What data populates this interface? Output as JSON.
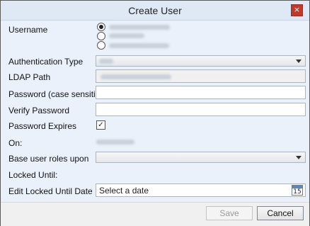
{
  "window": {
    "title": "Create User",
    "close_glyph": "×"
  },
  "form": {
    "username_label": "Username",
    "auth_type_label": "Authentication Type",
    "ldap_path_label": "LDAP Path",
    "password_label": "Password (case sensitive)",
    "verify_password_label": "Verify Password",
    "password_expires_label": "Password Expires",
    "password_expires_checked": true,
    "on_label": "On:",
    "base_roles_label": "Base user roles upon",
    "locked_until_label": "Locked Until:",
    "edit_locked_label": "Edit Locked Until Date",
    "date_placeholder": "Select a date",
    "calendar_day": "15"
  },
  "buttons": {
    "save": "Save",
    "cancel": "Cancel"
  },
  "icons": {
    "close": "close-icon",
    "calendar": "calendar-icon",
    "check": "check-icon",
    "chevron": "chevron-down-icon"
  },
  "colors": {
    "close_bg": "#c0392b",
    "content_bg": "#eaf1fb"
  }
}
